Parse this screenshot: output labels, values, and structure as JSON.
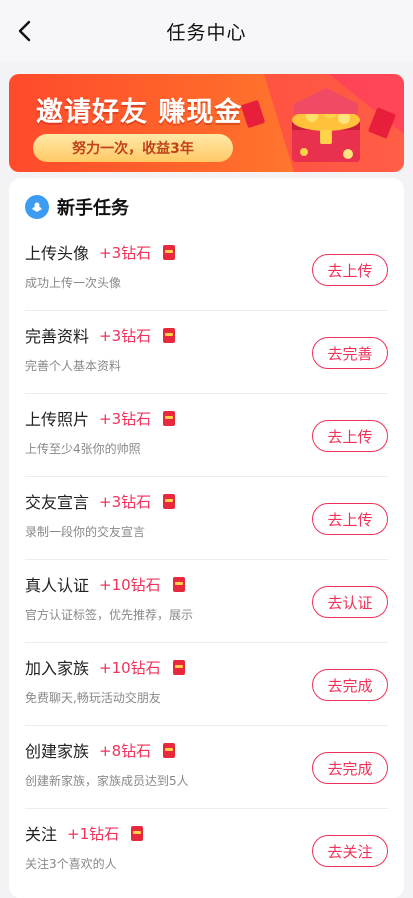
{
  "header": {
    "title": "任务中心",
    "back_icon": "chevron-left-icon"
  },
  "banner": {
    "headline": "邀请好友 赚现金",
    "subline": "努力一次，收益3年",
    "colors": {
      "start": "#ff4a2c",
      "end": "#ff8a3a",
      "pill_text": "#c0421c"
    }
  },
  "section": {
    "title": "新手任务",
    "icon": "badge-icon"
  },
  "tasks": [
    {
      "name": "上传头像",
      "reward": "+3钻石",
      "desc": "成功上传一次头像",
      "button": "去上传"
    },
    {
      "name": "完善资料",
      "reward": "+3钻石",
      "desc": "完善个人基本资料",
      "button": "去完善"
    },
    {
      "name": "上传照片",
      "reward": "+3钻石",
      "desc": "上传至少4张你的帅照",
      "button": "去上传"
    },
    {
      "name": "交友宣言",
      "reward": "+3钻石",
      "desc": "录制一段你的交友宣言",
      "button": "去上传"
    },
    {
      "name": "真人认证",
      "reward": "+10钻石",
      "desc": "官方认证标签，优先推荐，展示",
      "button": "去认证"
    },
    {
      "name": "加入家族",
      "reward": "+10钻石",
      "desc": "免费聊天,畅玩活动交朋友",
      "button": "去完成"
    },
    {
      "name": "创建家族",
      "reward": "+8钻石",
      "desc": "创建新家族，家族成员达到5人",
      "button": "去完成"
    },
    {
      "name": "关注",
      "reward": "+1钻石",
      "desc": "关注3个喜欢的人",
      "button": "去关注"
    }
  ],
  "accent_color": "#f0325a"
}
